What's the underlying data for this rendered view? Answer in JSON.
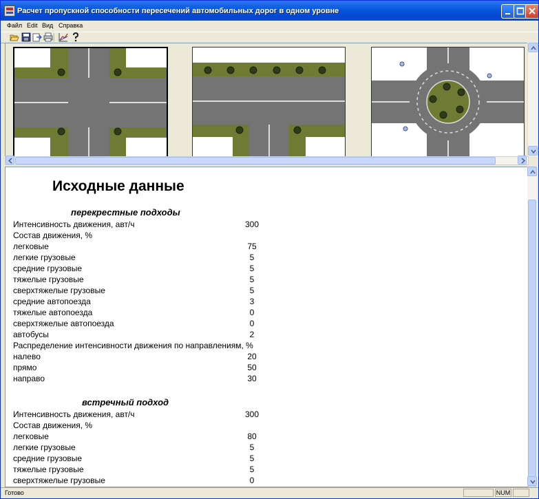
{
  "window": {
    "title": "Расчет пропускной способности пересечений автомобильных дорог в одном уровне"
  },
  "menu": [
    "Файл",
    "Edit",
    "Вид",
    "Справка"
  ],
  "toolbar": [
    "open-icon",
    "save-icon",
    "export-icon",
    "print-icon",
    "chart-icon",
    "help-icon"
  ],
  "thumbnails": [
    {
      "name": "four-way-intersection"
    },
    {
      "name": "t-junction"
    },
    {
      "name": "roundabout"
    }
  ],
  "document": {
    "title": "Исходные данные",
    "sections": [
      {
        "title": "перекрестные подходы",
        "rows": [
          {
            "label": "Интенсивность движения, авт/ч",
            "value": "300"
          },
          {
            "label": "Состав движения, %",
            "value": ""
          },
          {
            "label": "легковые",
            "value": "75"
          },
          {
            "label": "легкие грузовые",
            "value": "5"
          },
          {
            "label": "средние грузовые",
            "value": "5"
          },
          {
            "label": "тяжелые грузовые",
            "value": "5"
          },
          {
            "label": "сверхтяжелые грузовые",
            "value": "5"
          },
          {
            "label": "средние автопоезда",
            "value": "3"
          },
          {
            "label": "тяжелые автопоезда",
            "value": "0"
          },
          {
            "label": "сверхтяжелые автопоезда",
            "value": "0"
          },
          {
            "label": "автобусы",
            "value": "2"
          },
          {
            "label": "Распределение интенсивности движения по направлениям, %",
            "value": ""
          },
          {
            "label": "налево",
            "value": "20"
          },
          {
            "label": "прямо",
            "value": "50"
          },
          {
            "label": "направо",
            "value": "30"
          }
        ]
      },
      {
        "title": "встречный подход",
        "rows": [
          {
            "label": "Интенсивность движения, авт/ч",
            "value": "300"
          },
          {
            "label": "Состав движения, %",
            "value": ""
          },
          {
            "label": "легковые",
            "value": "80"
          },
          {
            "label": "легкие грузовые",
            "value": "5"
          },
          {
            "label": "средние грузовые",
            "value": "5"
          },
          {
            "label": "тяжелые грузовые",
            "value": "5"
          },
          {
            "label": "сверхтяжелые грузовые",
            "value": "0"
          }
        ]
      }
    ]
  },
  "status": {
    "text": "Готово",
    "num": "NUM"
  },
  "colors": {
    "grass": "#6f7a33",
    "road": "#747474",
    "titlebar": "#0a5ae0"
  }
}
